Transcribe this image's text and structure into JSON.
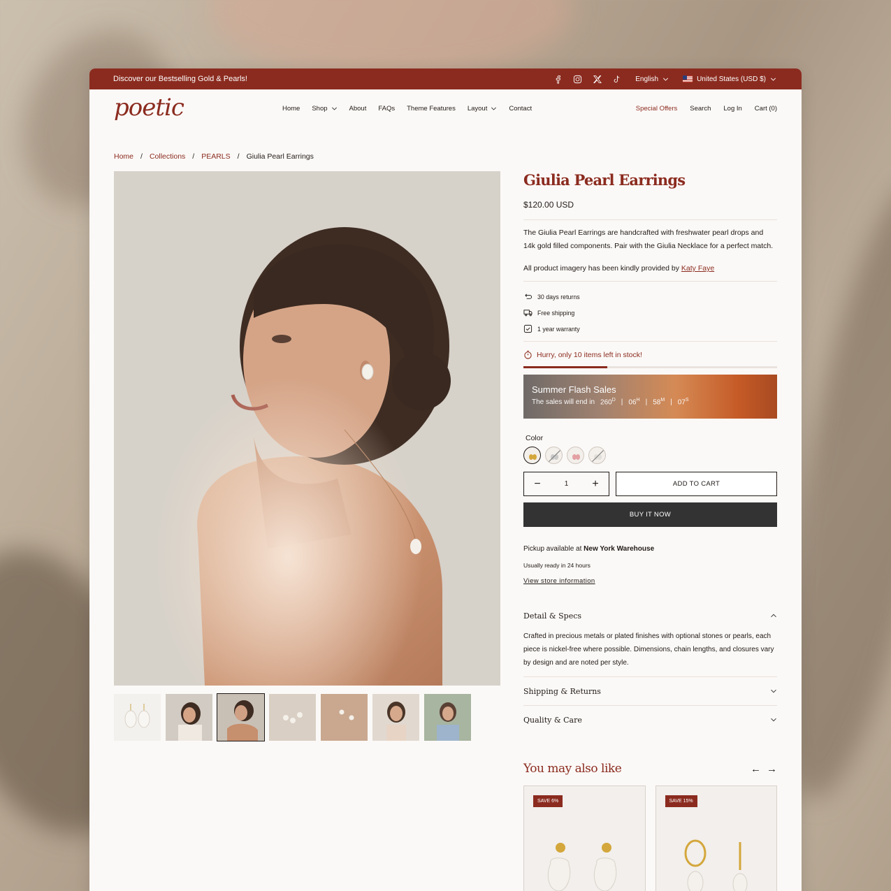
{
  "announcement": {
    "text": "Discover our Bestselling Gold & Pearls!",
    "language": "English",
    "region": "United States (USD $)"
  },
  "header": {
    "logo": "poetic",
    "nav": [
      "Home",
      "Shop",
      "About",
      "FAQs",
      "Theme Features",
      "Layout",
      "Contact"
    ],
    "special_offers": "Special Offers",
    "search": "Search",
    "login": "Log In",
    "cart": "Cart (0)"
  },
  "breadcrumb": {
    "home": "Home",
    "collections": "Collections",
    "pearls": "PEARLS",
    "current": "Giulia Pearl Earrings",
    "sep": "/"
  },
  "product": {
    "title": "Giulia Pearl Earrings",
    "price": "$120.00 USD",
    "description": "The Giulia Pearl Earrings are handcrafted with freshwater pearl drops and 14k gold filled components. Pair with the Giulia Necklace for a perfect match.",
    "credit_prefix": "All product imagery has been kindly provided by",
    "credit_link": "Katy Faye",
    "perks": [
      "30 days returns",
      "Free shipping",
      "1 year warranty"
    ],
    "stock_text": "Hurry, only 10 items left in stock!",
    "stock_level": 0.33,
    "color_label": "Color",
    "quantity": "1",
    "add_to_cart": "ADD TO CART",
    "buy_now": "BUY IT NOW"
  },
  "flash_sale": {
    "title": "Summer Flash Sales",
    "subtitle": "The sales will end in",
    "days": "260",
    "days_unit": "D",
    "hours": "06",
    "hours_unit": "H",
    "minutes": "58",
    "minutes_unit": "M",
    "seconds": "07",
    "seconds_unit": "S",
    "sep": "|"
  },
  "pickup": {
    "prefix": "Pickup available at",
    "location": "New York Warehouse",
    "ready": "Usually ready in 24 hours",
    "view": "View store information"
  },
  "accordions": [
    {
      "title": "Detail & Specs",
      "body": "Crafted in precious metals or plated finishes with optional stones or pearls, each piece is nickel-free where possible. Dimensions, chain lengths, and closures vary by design and are noted per style."
    },
    {
      "title": "Shipping & Returns"
    },
    {
      "title": "Quality & Care"
    }
  ],
  "related": {
    "title": "You may also like",
    "badges": [
      "SAVE 6%",
      "SAVE 15%"
    ]
  },
  "colors": {
    "accent": "#8b2b1f",
    "dark_button": "#333333"
  }
}
